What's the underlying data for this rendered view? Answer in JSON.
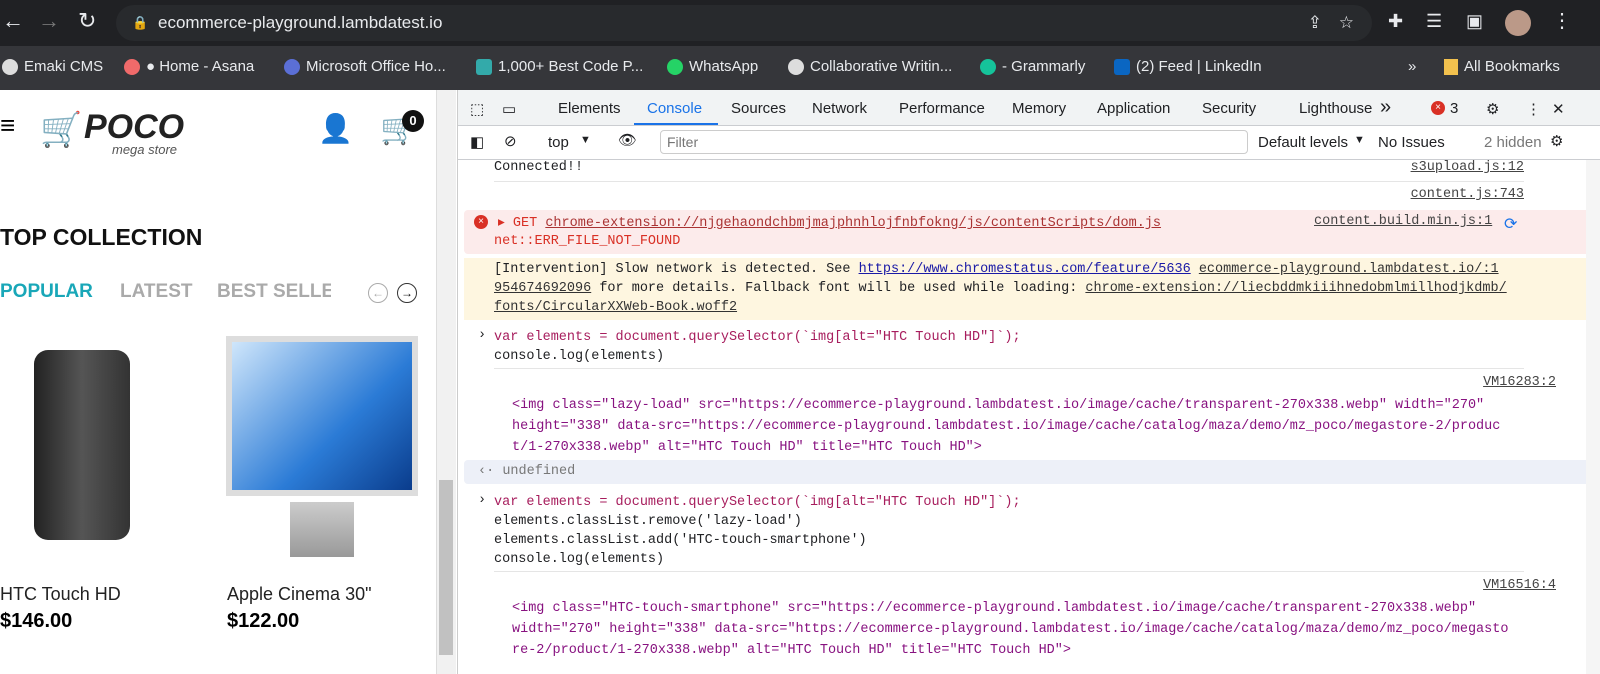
{
  "browser": {
    "url": "ecommerce-playground.lambdatest.io",
    "bookmarks": [
      "Emaki CMS",
      "● Home - Asana",
      "Microsoft Office Ho...",
      "1,000+ Best Code P...",
      "WhatsApp",
      "Collaborative Writin...",
      "- Grammarly",
      "(2) Feed | LinkedIn"
    ],
    "more": "»",
    "all_bookmarks": "All Bookmarks"
  },
  "site": {
    "logo": "POCO",
    "logo_sub": "mega store",
    "cart_count": "0",
    "section_title": "TOP COLLECTION",
    "tabs": [
      "POPULAR",
      "LATEST",
      "BEST SELLE"
    ],
    "products": [
      {
        "name": "HTC Touch HD",
        "price": "$146.00"
      },
      {
        "name": "Apple Cinema 30\"",
        "price": "$122.00"
      }
    ]
  },
  "devtools": {
    "tabs": [
      "Elements",
      "Console",
      "Sources",
      "Network",
      "Performance",
      "Memory",
      "Application",
      "Security",
      "Lighthouse"
    ],
    "more_tabs": "»",
    "error_count": "3",
    "context": "top",
    "filter_placeholder": "Filter",
    "levels": "Default levels",
    "issues": "No Issues",
    "hidden": "2 hidden",
    "console": {
      "l1": {
        "text": "Connected!!",
        "src": "s3upload.js:12"
      },
      "l2": {
        "src": "content.js:743"
      },
      "err": {
        "method": "GET",
        "url": "chrome-extension://njgehaondchbmjmajphnhlojfnbfokng/js/contentScripts/dom.js",
        "detail": "net::ERR_FILE_NOT_FOUND",
        "src": "content.build.min.js:1"
      },
      "warn": {
        "a": "[Intervention] Slow network is detected. See ",
        "link1": "https://www.chromestatus.com/feature/5636",
        "link2": "ecommerce-playground.lambdatest.io/:1",
        "l2a": "954674692096",
        "l2b": " for more details. Fallback font will be used while loading: ",
        "link3": "chrome-extension://liecbddmkiiihnedobmlmillhodjkdmb/",
        "link4": "fonts/CircularXXWeb-Book.woff2"
      },
      "in1": [
        "var elements = document.querySelector(`img[alt=\"HTC Touch HD\"]`);",
        "console.log(elements)"
      ],
      "out1": {
        "src": "VM16283:2",
        "lines": [
          "<img class=\"lazy-load\" src=\"https://ecommerce-playground.lambdatest.io/image/cache/transparent-270x338.webp\" width=\"270\"",
          "height=\"338\" data-src=\"https://ecommerce-playground.lambdatest.io/image/cache/catalog/maza/demo/mz_poco/megastore-2/produc",
          "t/1-270x338.webp\" alt=\"HTC Touch HD\" title=\"HTC Touch HD\">"
        ]
      },
      "ret": "undefined",
      "in2": [
        "var elements = document.querySelector(`img[alt=\"HTC Touch HD\"]`);",
        "elements.classList.remove('lazy-load')",
        "elements.classList.add('HTC-touch-smartphone')",
        "console.log(elements)"
      ],
      "out2": {
        "src": "VM16516:4",
        "lines": [
          "<img class=\"HTC-touch-smartphone\" src=\"https://ecommerce-playground.lambdatest.io/image/cache/transparent-270x338.webp\"",
          "width=\"270\" height=\"338\" data-src=\"https://ecommerce-playground.lambdatest.io/image/cache/catalog/maza/demo/mz_poco/megasto",
          "re-2/product/1-270x338.webp\" alt=\"HTC Touch HD\" title=\"HTC Touch HD\">"
        ]
      }
    }
  }
}
